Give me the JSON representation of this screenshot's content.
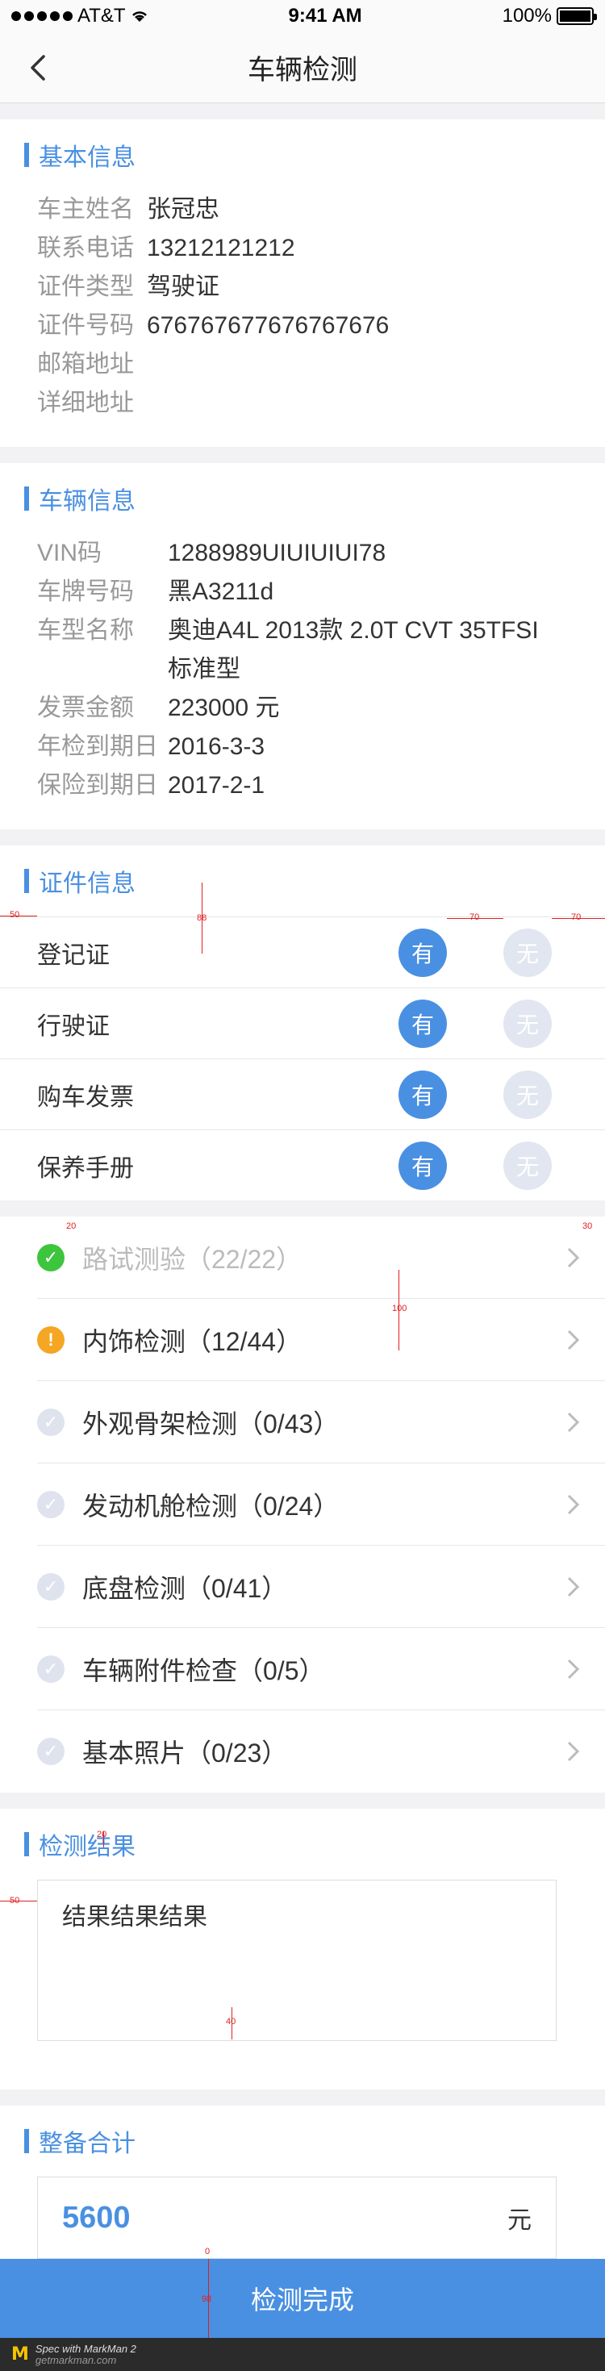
{
  "status_bar": {
    "carrier": "AT&T",
    "time": "9:41 AM",
    "battery": "100%"
  },
  "nav": {
    "title": "车辆检测"
  },
  "basic": {
    "title": "基本信息",
    "rows": [
      {
        "label": "车主姓名",
        "value": "张冠忠"
      },
      {
        "label": "联系电话",
        "value": "13212121212"
      },
      {
        "label": "证件类型",
        "value": "驾驶证"
      },
      {
        "label": "证件号码",
        "value": "676767677676767676"
      },
      {
        "label": "邮箱地址",
        "value": ""
      },
      {
        "label": "详细地址",
        "value": ""
      }
    ]
  },
  "vehicle": {
    "title": "车辆信息",
    "rows": [
      {
        "label": "VIN码",
        "value": "1288989UIUIUIUI78"
      },
      {
        "label": "车牌号码",
        "value": "黑A3211d"
      },
      {
        "label": "车型名称",
        "value": "奥迪A4L 2013款 2.0T CVT 35TFSI",
        "value2": "标准型"
      },
      {
        "label": "发票金额",
        "value": "223000 元"
      },
      {
        "label": "年检到期日",
        "value": "2016-3-3"
      },
      {
        "label": "保险到期日",
        "value": "2017-2-1"
      }
    ]
  },
  "certificates": {
    "title": "证件信息",
    "yes_label": "有",
    "no_label": "无",
    "items": [
      {
        "label": "登记证",
        "selected": "yes"
      },
      {
        "label": "行驶证",
        "selected": "yes"
      },
      {
        "label": "购车发票",
        "selected": "yes"
      },
      {
        "label": "保养手册",
        "selected": "yes"
      }
    ]
  },
  "checks": {
    "items": [
      {
        "label": "路试测验（22/22）",
        "status": "complete",
        "icon": "check-circle-icon"
      },
      {
        "label": "内饰检测（12/44）",
        "status": "warning",
        "icon": "exclamation-circle-icon"
      },
      {
        "label": "外观骨架检测（0/43）",
        "status": "pending",
        "icon": "check-circle-icon"
      },
      {
        "label": "发动机舱检测（0/24）",
        "status": "pending",
        "icon": "check-circle-icon"
      },
      {
        "label": "底盘检测（0/41）",
        "status": "pending",
        "icon": "check-circle-icon"
      },
      {
        "label": "车辆附件检查（0/5）",
        "status": "pending",
        "icon": "check-circle-icon"
      },
      {
        "label": "基本照片（0/23）",
        "status": "pending",
        "icon": "check-circle-icon"
      }
    ]
  },
  "result": {
    "title": "检测结果",
    "text": "结果结果结果"
  },
  "total": {
    "title": "整备合计",
    "value": "5600",
    "unit": "元"
  },
  "done_button": {
    "label": "检测完成"
  },
  "footer": {
    "line1": "Spec with MarkMan 2",
    "line2": "getmarkman.com"
  },
  "annotations": {
    "cert_left": "50",
    "cert_height": "88",
    "cert_gap": "70",
    "cert_right": "70",
    "check_icon_gap": "20",
    "check_right": "30",
    "check_height": "100",
    "result_top": "20",
    "result_left": "50",
    "result_bottom": "40",
    "btn_top": "0",
    "btn_height": "98"
  },
  "colors": {
    "accent": "#4a90e2",
    "ok": "#3ec53e",
    "warn": "#f5a623",
    "pending": "#dfe3ee"
  }
}
